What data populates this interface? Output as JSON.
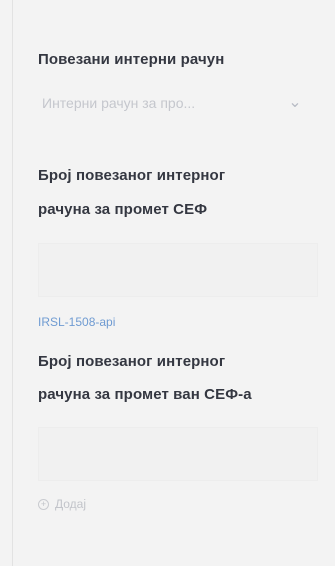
{
  "form": {
    "linked_internal_invoice_label": "Повезани интерни рачун",
    "linked_internal_invoice_placeholder": "Интерни рачун за про...",
    "sef_number_label_line1": "Број повезаног интерног",
    "sef_number_label_line2": "рачуна за промет СЕФ",
    "linked_code": "IRSL-1508-api",
    "non_sef_number_label_line1": "Број повезаног интерног",
    "non_sef_number_label_line2": "рачуна за промет ван СЕФ-а",
    "add_label": "Додај"
  },
  "icons": {
    "dropdown": "chevron-down-icon",
    "add": "plus-circle-icon"
  },
  "colors": {
    "background": "#f3f3f3",
    "label": "#343741",
    "placeholder": "#c5c7cd",
    "link": "#6f9bd2"
  }
}
